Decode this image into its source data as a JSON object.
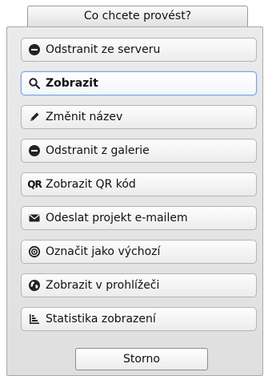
{
  "dialog": {
    "title": "Co chcete provést?",
    "cancel_label": "Storno"
  },
  "menu": {
    "items": [
      {
        "icon": "minus-circle-icon",
        "label": "Odstranit ze serveru"
      },
      {
        "icon": "search-icon",
        "label": "Zobrazit",
        "selected": true
      },
      {
        "icon": "pencil-icon",
        "label": "Změnit název"
      },
      {
        "icon": "minus-circle-icon",
        "label": "Odstranit z galerie"
      },
      {
        "icon": "qr-icon",
        "label": "Zobrazit QR kód",
        "icon_text": "QR"
      },
      {
        "icon": "envelope-icon",
        "label": "Odeslat projekt e-mailem"
      },
      {
        "icon": "target-icon",
        "label": "Označit jako výchozí"
      },
      {
        "icon": "globe-icon",
        "label": "Zobrazit v prohlížeči"
      },
      {
        "icon": "bar-chart-icon",
        "label": "Statistika zobrazení"
      }
    ]
  }
}
